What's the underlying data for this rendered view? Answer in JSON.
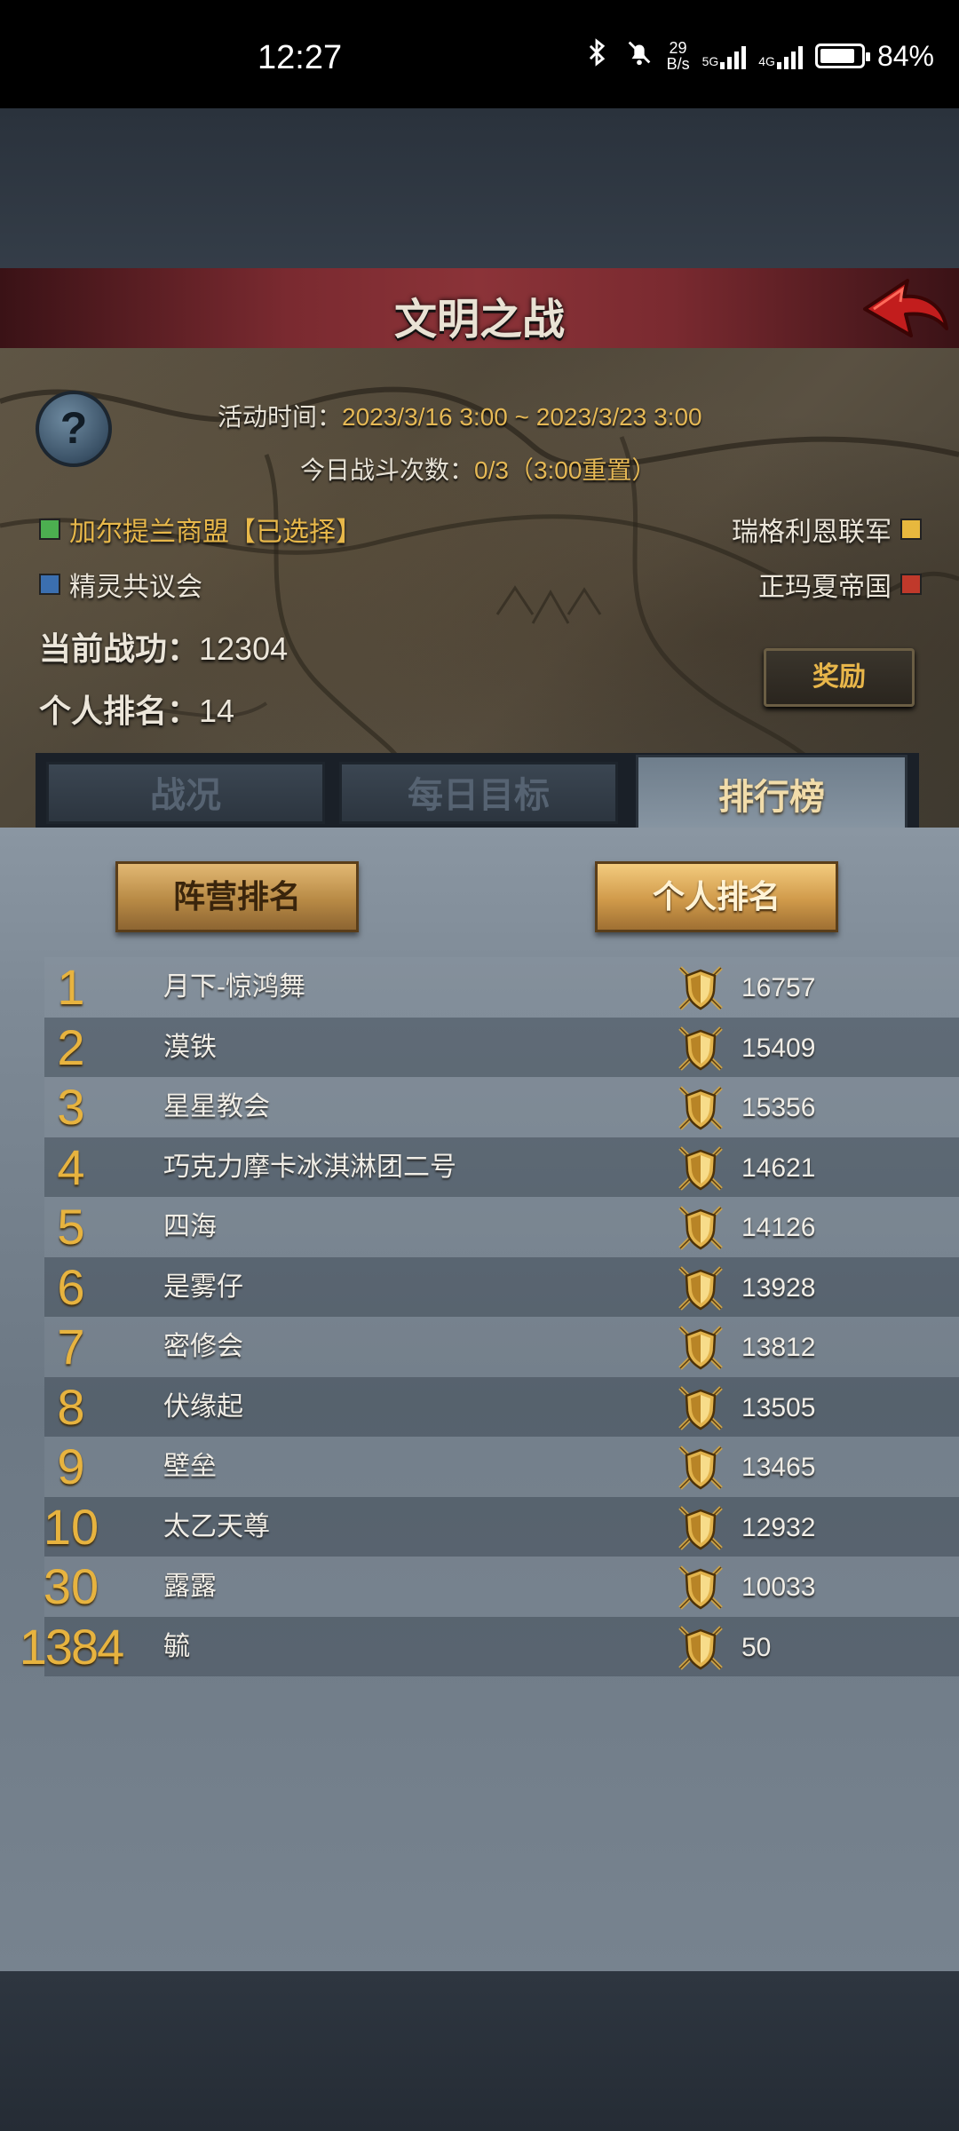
{
  "status_bar": {
    "time": "12:27",
    "net_speed_value": "29",
    "net_speed_unit": "B/s",
    "sim1_label": "5G",
    "sim2_label": "4G",
    "battery": "84%"
  },
  "header": {
    "title": "文明之战",
    "back_icon": "red-arrow-back-icon"
  },
  "info": {
    "activity_time_label": "活动时间：",
    "activity_time_value": "2023/3/16 3:00 ~ 2023/3/23 3:00",
    "daily_battles_label": "今日战斗次数：",
    "daily_battles_value": "0/3（3:00重置）",
    "factions": [
      {
        "name": "加尔提兰商盟【已选择】",
        "color": "#4caf50",
        "text_color": "#e8b84a"
      },
      {
        "name": "瑞格利恩联军",
        "color": "#e7b83e",
        "text_color": "#ece6da"
      },
      {
        "name": "精灵共议会",
        "color": "#3b6fb0",
        "text_color": "#ece6da"
      },
      {
        "name": "正玛夏帝国",
        "color": "#c0392b",
        "text_color": "#ece6da"
      }
    ],
    "merit_label": "当前战功：",
    "merit_value": "12304",
    "personal_rank_label": "个人排名：",
    "personal_rank_value": "14",
    "reward_button": "奖励"
  },
  "tabs": [
    {
      "label": "战况",
      "active": false
    },
    {
      "label": "每日目标",
      "active": false
    },
    {
      "label": "排行榜",
      "active": true
    }
  ],
  "ranking": {
    "faction_rank_button": "阵营排名",
    "personal_rank_button": "个人排名",
    "selected": "personal",
    "rows": [
      {
        "rank": "1",
        "name": "月下-惊鸿舞",
        "score": "16757"
      },
      {
        "rank": "2",
        "name": "漠铁",
        "score": "15409"
      },
      {
        "rank": "3",
        "name": "星星教会",
        "score": "15356"
      },
      {
        "rank": "4",
        "name": "巧克力摩卡冰淇淋团二号",
        "score": "14621"
      },
      {
        "rank": "5",
        "name": "四海",
        "score": "14126"
      },
      {
        "rank": "6",
        "name": "是雾仔",
        "score": "13928"
      },
      {
        "rank": "7",
        "name": "密修会",
        "score": "13812"
      },
      {
        "rank": "8",
        "name": "伏缘起",
        "score": "13505"
      },
      {
        "rank": "9",
        "name": "壁垒",
        "score": "13465"
      },
      {
        "rank": "10",
        "name": "太乙天尊",
        "score": "12932"
      },
      {
        "rank": "30",
        "name": "露露",
        "score": "10033"
      },
      {
        "rank": "1384",
        "name": "毓",
        "score": "50"
      }
    ],
    "medal_icon": "shield-swords-medal-icon"
  }
}
